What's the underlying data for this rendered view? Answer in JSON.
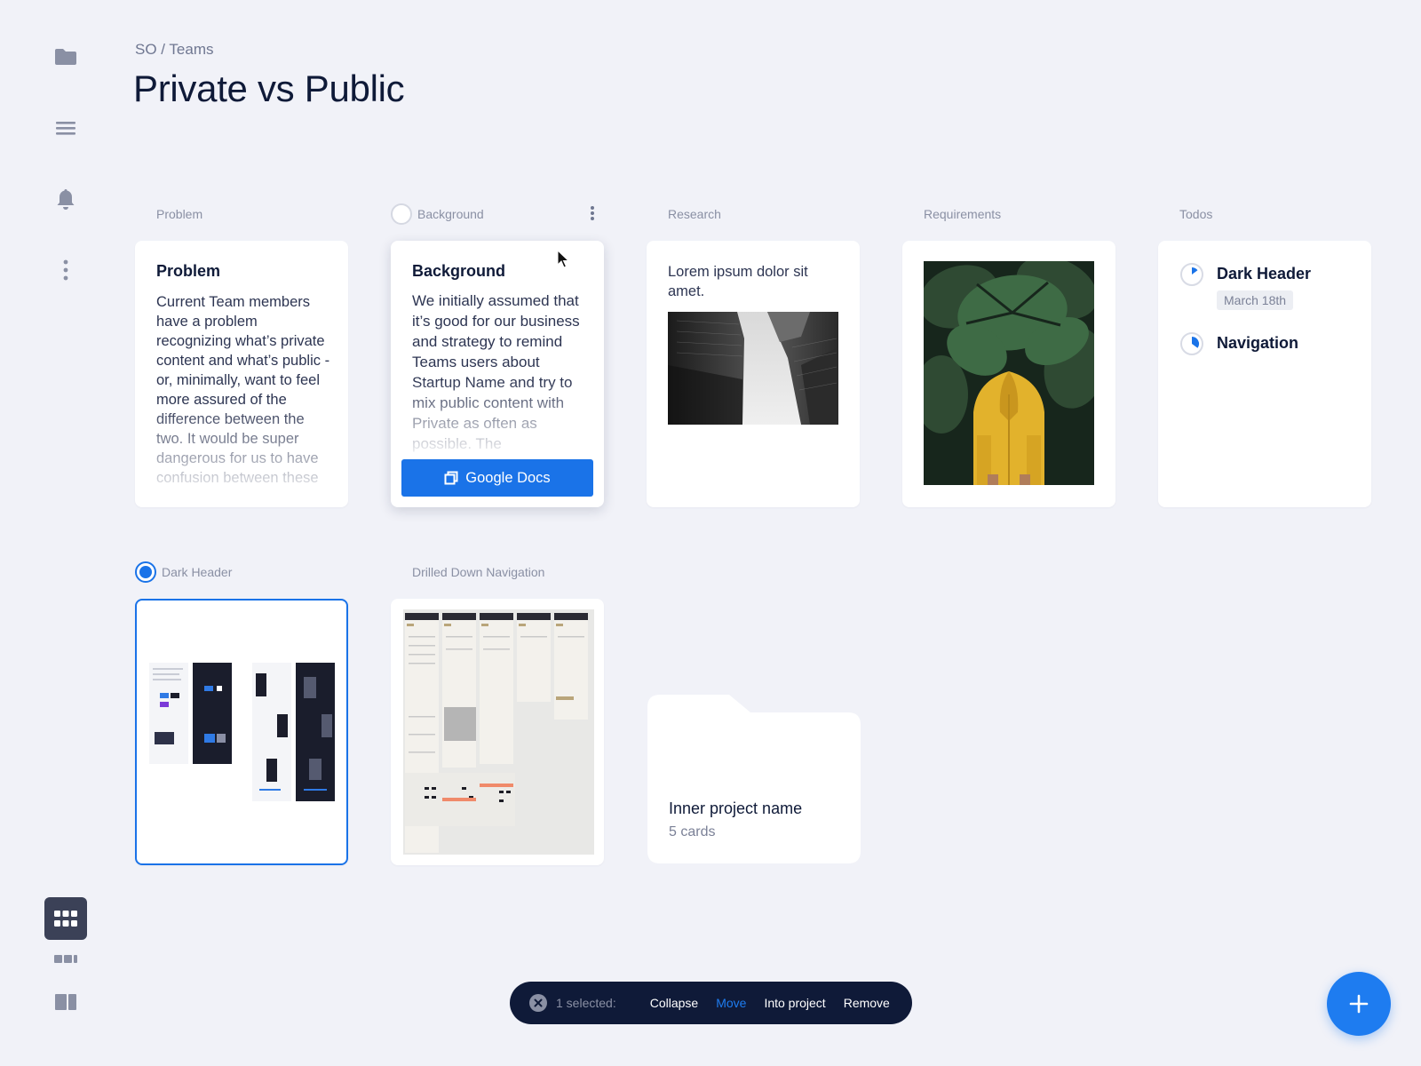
{
  "header": {
    "breadcrumb": "SO / Teams",
    "title": "Private vs Public"
  },
  "sidebar": {
    "items": [
      {
        "icon": "folder-icon"
      },
      {
        "icon": "menu-icon"
      },
      {
        "icon": "bell-icon"
      },
      {
        "icon": "more-vertical-icon"
      }
    ],
    "view_modes": [
      {
        "icon": "grid-view-icon",
        "active": true
      },
      {
        "icon": "carousel-view-icon",
        "active": false
      },
      {
        "icon": "split-view-icon",
        "active": false
      }
    ]
  },
  "columns": [
    {
      "label": "Problem"
    },
    {
      "label": "Background"
    },
    {
      "label": "Research"
    },
    {
      "label": "Requirements"
    },
    {
      "label": "Todos"
    },
    {
      "label": "Dark Header"
    },
    {
      "label": "Drilled Down Navigation"
    }
  ],
  "cards": {
    "problem": {
      "title": "Problem",
      "body": "Current Team members have a problem recognizing what’s private content and what’s public - or, minimally, want to feel more assured of the difference between the two. It would be super dangerous for us to have confusion between these"
    },
    "background": {
      "title": "Background",
      "body": "We initially assumed that it’s good for our business and strategy to remind Teams users about Startup Name and try to mix public content with Private as often as possible. The",
      "button_label": "Google Docs"
    },
    "research": {
      "body": "Lorem ipsum dolor sit amet."
    },
    "todos": {
      "items": [
        {
          "title": "Dark Header",
          "date": "March 18th",
          "progress": 0.15
        },
        {
          "title": "Navigation",
          "progress": 0.35
        }
      ]
    }
  },
  "folder": {
    "title": "Inner project name",
    "count": "5 cards"
  },
  "selection_bar": {
    "selected_text": "1 selected:",
    "actions": [
      "Collapse",
      "Move",
      "Into project",
      "Remove"
    ],
    "active_action": "Move"
  },
  "colors": {
    "background": "#f1f2f8",
    "accent": "#1a73e8",
    "navy": "#0f1a38",
    "muted": "#8a90a4"
  }
}
